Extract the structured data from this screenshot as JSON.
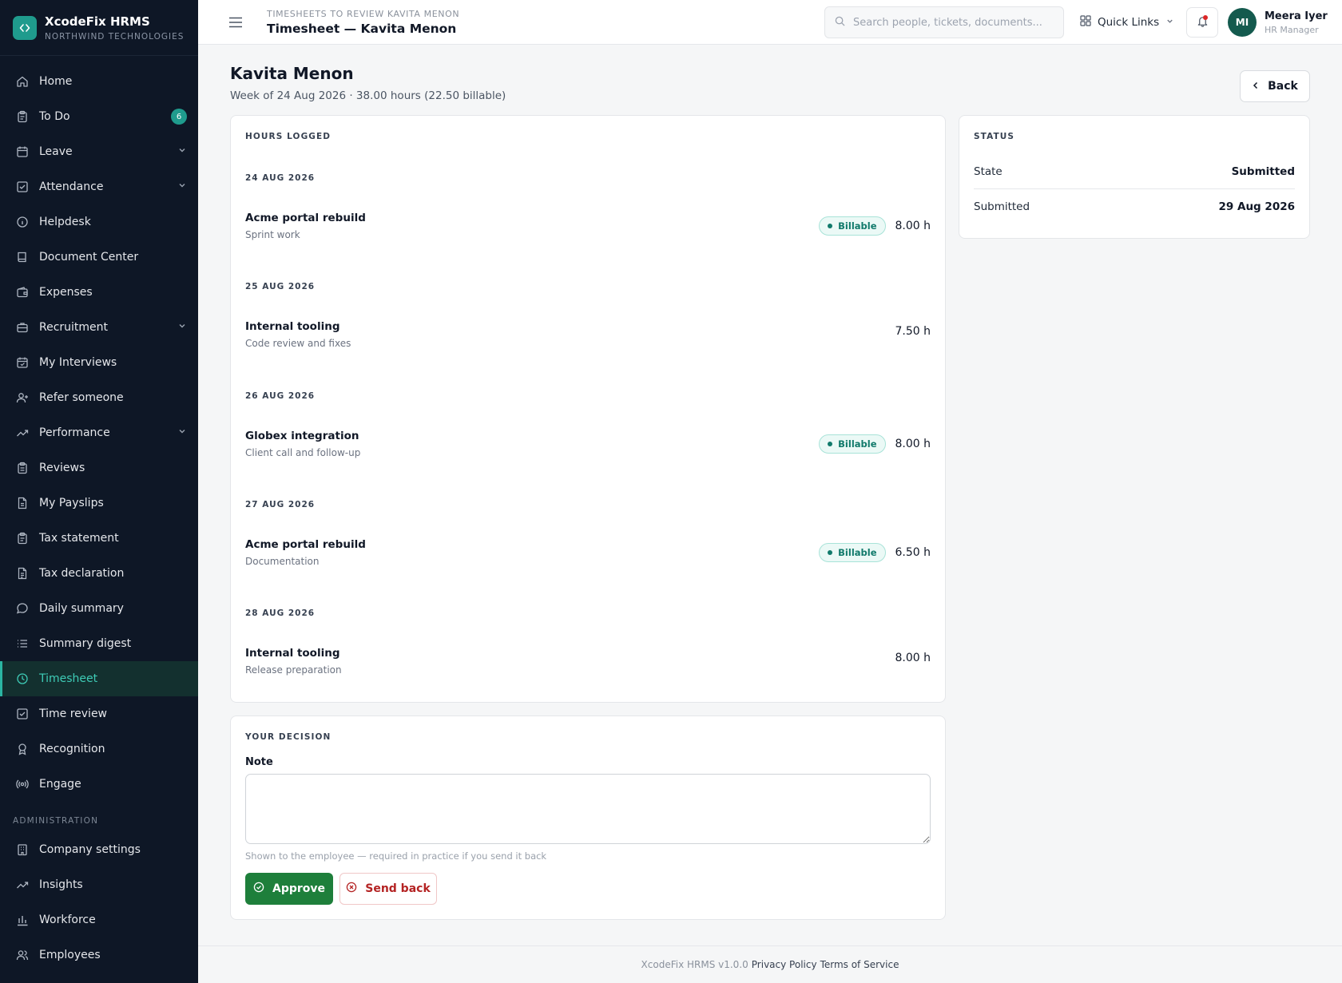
{
  "brand": {
    "name": "XcodeFix HRMS",
    "org": "NORTHWIND TECHNOLOGIES"
  },
  "sidebar": {
    "items": [
      {
        "label": "Home",
        "icon": "home-icon"
      },
      {
        "label": "To Do",
        "icon": "clipboard-icon",
        "badge": "6"
      },
      {
        "label": "Leave",
        "icon": "calendar-icon",
        "expandable": true
      },
      {
        "label": "Attendance",
        "icon": "check-square-icon",
        "expandable": true
      },
      {
        "label": "Helpdesk",
        "icon": "info-icon"
      },
      {
        "label": "Document Center",
        "icon": "book-icon"
      },
      {
        "label": "Expenses",
        "icon": "wallet-icon"
      },
      {
        "label": "Recruitment",
        "icon": "briefcase-icon",
        "expandable": true
      },
      {
        "label": "My Interviews",
        "icon": "calendar-check-icon"
      },
      {
        "label": "Refer someone",
        "icon": "user-plus-icon"
      },
      {
        "label": "Performance",
        "icon": "trending-up-icon",
        "expandable": true
      },
      {
        "label": "Reviews",
        "icon": "clipboard-list-icon"
      },
      {
        "label": "My Payslips",
        "icon": "file-icon"
      },
      {
        "label": "Tax statement",
        "icon": "clipboard-icon"
      },
      {
        "label": "Tax declaration",
        "icon": "file-text-icon"
      },
      {
        "label": "Daily summary",
        "icon": "message-circle-icon"
      },
      {
        "label": "Summary digest",
        "icon": "list-icon"
      },
      {
        "label": "Timesheet",
        "icon": "clock-icon",
        "active": true
      },
      {
        "label": "Time review",
        "icon": "check-square-icon"
      },
      {
        "label": "Recognition",
        "icon": "award-icon"
      },
      {
        "label": "Engage",
        "icon": "radio-icon"
      }
    ],
    "admin_section": "ADMINISTRATION",
    "admin_items": [
      {
        "label": "Company settings",
        "icon": "building-icon"
      },
      {
        "label": "Insights",
        "icon": "trending-up-icon"
      },
      {
        "label": "Workforce",
        "icon": "bar-chart-icon"
      },
      {
        "label": "Employees",
        "icon": "users-icon"
      }
    ]
  },
  "topbar": {
    "breadcrumb": "TIMESHEETS TO REVIEW KAVITA MENON",
    "title": "Timesheet — Kavita Menon",
    "search_placeholder": "Search people, tickets, documents...",
    "quick_links": "Quick Links",
    "user_initials": "MI",
    "user_name": "Meera Iyer",
    "user_role": "HR Manager"
  },
  "page": {
    "name": "Kavita Menon",
    "subtitle": "Week of 24 Aug 2026 · 38.00 hours (22.50 billable)",
    "back_label": "Back"
  },
  "hours": {
    "label": "HOURS LOGGED",
    "days": [
      {
        "date": "24 AUG 2026",
        "project": "Acme portal rebuild",
        "desc": "Sprint work",
        "billable": true,
        "hours": "8.00 h"
      },
      {
        "date": "25 AUG 2026",
        "project": "Internal tooling",
        "desc": "Code review and fixes",
        "billable": false,
        "hours": "7.50 h"
      },
      {
        "date": "26 AUG 2026",
        "project": "Globex integration",
        "desc": "Client call and follow-up",
        "billable": true,
        "hours": "8.00 h"
      },
      {
        "date": "27 AUG 2026",
        "project": "Acme portal rebuild",
        "desc": "Documentation",
        "billable": true,
        "hours": "6.50 h"
      },
      {
        "date": "28 AUG 2026",
        "project": "Internal tooling",
        "desc": "Release preparation",
        "billable": false,
        "hours": "8.00 h"
      }
    ],
    "billable_label": "Billable"
  },
  "status": {
    "label": "STATUS",
    "state_key": "State",
    "state_value": "Submitted",
    "submitted_key": "Submitted",
    "submitted_value": "29 Aug 2026"
  },
  "decision": {
    "label": "YOUR DECISION",
    "note_label": "Note",
    "note_value": "",
    "hint": "Shown to the employee — required in practice if you send it back",
    "approve_label": "Approve",
    "send_back_label": "Send back"
  },
  "footer": {
    "version": "XcodeFix HRMS v1.0.0",
    "privacy": "Privacy Policy",
    "terms": "Terms of Service"
  },
  "colors": {
    "sidebar_bg": "#0e1726",
    "accent": "#1f9b8d",
    "approve": "#1e7f3b",
    "send_back": "#b42323"
  }
}
